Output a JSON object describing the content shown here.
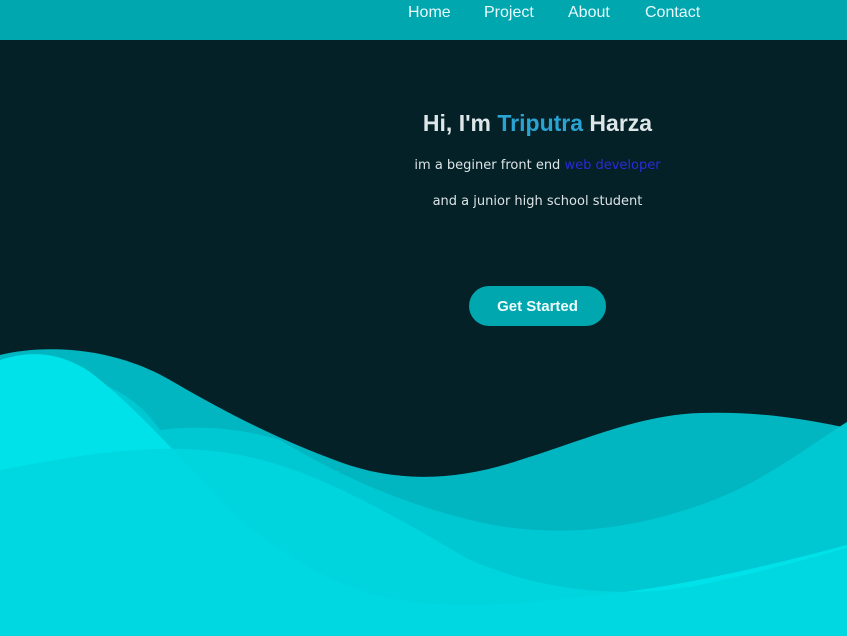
{
  "nav": {
    "items": [
      "Home",
      "Project",
      "About",
      "Contact"
    ]
  },
  "hero": {
    "greeting": "Hi, I'm",
    "first_name": "Triputra",
    "last_name": "Harza",
    "line1_prefix": "im a beginer front end",
    "line1_highlight": "web developer",
    "line2": "and a junior high school student",
    "cta_label": "Get Started"
  },
  "colors": {
    "background": "#032127",
    "navbar": "#00a7af",
    "accent_name": "#2aa4d2",
    "accent_highlight": "#2d2ad8",
    "wave": "#00dce4"
  }
}
